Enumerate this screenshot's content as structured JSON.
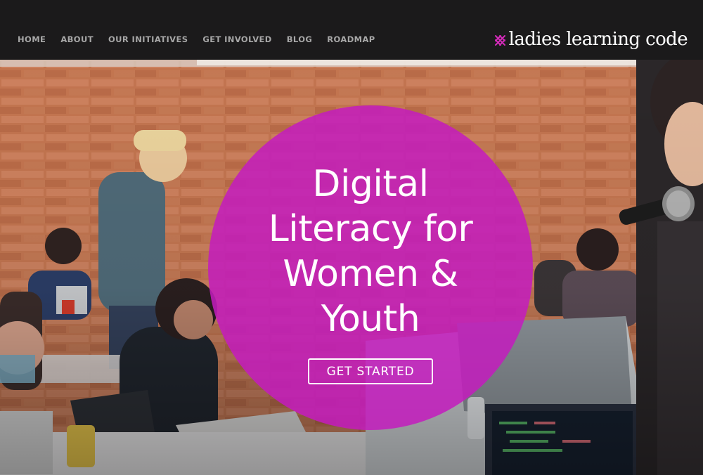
{
  "nav": {
    "items": [
      {
        "label": "HOME"
      },
      {
        "label": "ABOUT"
      },
      {
        "label": "OUR INITIATIVES"
      },
      {
        "label": "GET INVOLVED"
      },
      {
        "label": "BLOG"
      },
      {
        "label": "ROADMAP"
      }
    ]
  },
  "brand": {
    "name": "ladies learning code",
    "logo_icon": "double-x-icon",
    "accent": "#d22ab8"
  },
  "hero": {
    "headline_lines": [
      "Digital",
      "Literacy for",
      "Women &",
      "Youth"
    ],
    "cta_label": "GET STARTED",
    "circle_color": "#c41cbe"
  }
}
